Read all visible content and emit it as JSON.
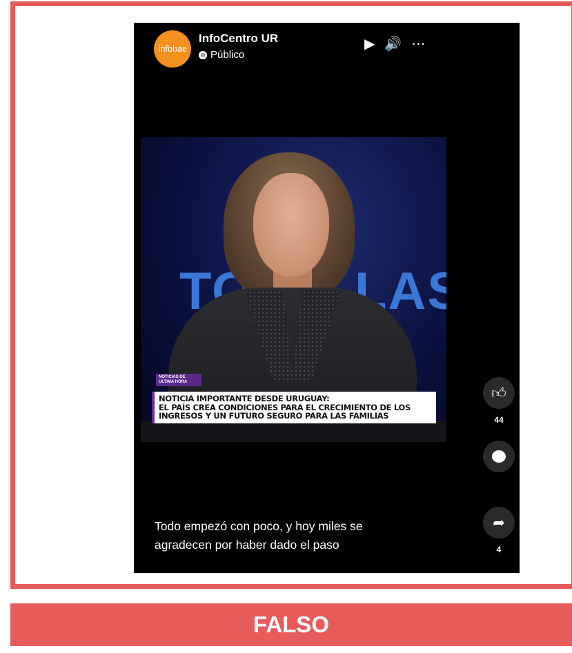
{
  "post": {
    "channel_name": "InfoCentro UR",
    "avatar_text": "infobae",
    "privacy_label": "Público",
    "privacy_icon": "globe-icon",
    "controls": {
      "play_icon": "play-icon",
      "volume_icon": "volume-icon",
      "more_icon": "more-icon"
    },
    "caption_line1": "Todo empezó con poco, y hoy miles se",
    "caption_line2": "agradecen por haber dado el paso"
  },
  "video": {
    "background_text_left": "TO",
    "background_text_right": "LAS",
    "tag_line1": "NOTICIAS DE",
    "tag_line2": "ULTIMA HORA",
    "headline_line1": "NOTICIA IMPORTANTE DESDE URUGUAY:",
    "headline_line2": "EL PAÍS CREA CONDICIONES PARA EL CRECIMIENTO DE LOS",
    "headline_line3": "INGRESOS Y UN FUTURO SEGURO PARA LAS FAMILIAS"
  },
  "actions": {
    "like_count": "44",
    "share_count": "4"
  },
  "verdict": {
    "label": "FALSO"
  },
  "colors": {
    "accent_red": "#e85b5b",
    "avatar_orange": "#f3901e",
    "tag_purple": "#5a2a8a"
  }
}
